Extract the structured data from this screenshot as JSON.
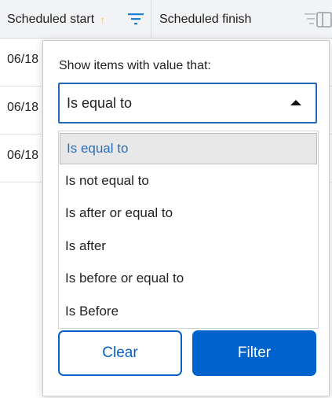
{
  "header": {
    "col_start": "Scheduled start",
    "col_finish": "Scheduled finish",
    "sort_indicator": "↑"
  },
  "rows": [
    {
      "start": "06/18"
    },
    {
      "start": "06/18"
    },
    {
      "start": "06/18"
    }
  ],
  "filter_popup": {
    "label": "Show items with value that:",
    "selected_value": "Is equal to",
    "options": [
      "Is equal to",
      "Is not equal to",
      "Is after or equal to",
      "Is after",
      "Is before or equal to",
      "Is Before"
    ],
    "clear_label": "Clear",
    "filter_label": "Filter"
  },
  "colors": {
    "accent": "#0062cc",
    "selected_text": "#2a6ebb",
    "sort_arrow": "#f1c36b"
  },
  "icons": {
    "filter": "filter-icon",
    "column_menu": "column-menu-icon"
  }
}
